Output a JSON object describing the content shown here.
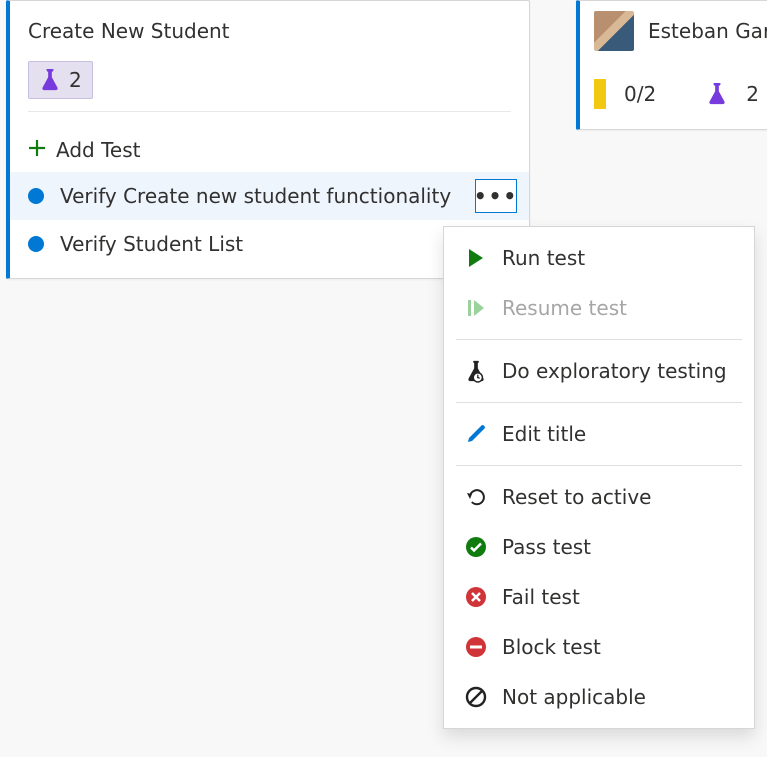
{
  "left_card": {
    "title": "Create New Student",
    "beaker_count": "2",
    "add_test_label": "Add Test",
    "tests": [
      {
        "label": "Verify Create new student functionality",
        "selected": true
      },
      {
        "label": "Verify Student List",
        "selected": false
      }
    ]
  },
  "right_card": {
    "user_name": "Esteban Gar",
    "tally": "0/2",
    "beaker_count": "2"
  },
  "context_menu": {
    "run_test": "Run test",
    "resume_test": "Resume test",
    "exploratory": "Do exploratory testing",
    "edit_title": "Edit title",
    "reset_active": "Reset to active",
    "pass_test": "Pass test",
    "fail_test": "Fail test",
    "block_test": "Block test",
    "not_applicable": "Not applicable"
  }
}
